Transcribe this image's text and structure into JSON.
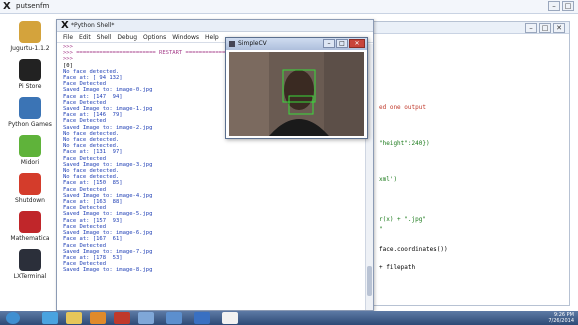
{
  "outer": {
    "title": "putsenfm"
  },
  "desktop_icons": [
    {
      "label": "Jugurtu-1.1.2",
      "color": "#d4a33c"
    },
    {
      "label": "Pi Store",
      "color": "#222222"
    },
    {
      "label": "Python Games",
      "color": "#3b74b5"
    },
    {
      "label": "Midori",
      "color": "#5fb33a"
    },
    {
      "label": "Shutdown",
      "color": "#d43c2b"
    },
    {
      "label": "Mathematica",
      "color": "#c0262a"
    },
    {
      "label": "LXTerminal",
      "color": "#2b2f3a"
    }
  ],
  "shell": {
    "title": "*Python Shell*",
    "menu": [
      "File",
      "Edit",
      "Shell",
      "Debug",
      "Options",
      "Windows",
      "Help"
    ],
    "lines": [
      {
        "text": ">>> ",
        "color": "#a53d8a"
      },
      {
        "text": ">>> ======================== RESTART ========================",
        "color": "#a53d8a"
      },
      {
        "text": ">>> ",
        "color": "#a53d8a"
      },
      {
        "text": "[0]",
        "color": "#000000"
      },
      {
        "text": "No face detected.",
        "color": "#1f3fb5"
      },
      {
        "text": "Face at: [ 94 132]",
        "color": "#1f3fb5"
      },
      {
        "text": "Face Detected",
        "color": "#1f3fb5"
      },
      {
        "text": "Saved Image to: image-0.jpg",
        "color": "#1f3fb5"
      },
      {
        "text": "Face at: [147  94]",
        "color": "#1f3fb5"
      },
      {
        "text": "Face Detected",
        "color": "#1f3fb5"
      },
      {
        "text": "Saved Image to: image-1.jpg",
        "color": "#1f3fb5"
      },
      {
        "text": "Face at: [146  79]",
        "color": "#1f3fb5"
      },
      {
        "text": "Face Detected",
        "color": "#1f3fb5"
      },
      {
        "text": "Saved Image to: image-2.jpg",
        "color": "#1f3fb5"
      },
      {
        "text": "No face detected.",
        "color": "#1f3fb5"
      },
      {
        "text": "No face detected.",
        "color": "#1f3fb5"
      },
      {
        "text": "No face detected.",
        "color": "#1f3fb5"
      },
      {
        "text": "Face at: [131  97]",
        "color": "#1f3fb5"
      },
      {
        "text": "Face Detected",
        "color": "#1f3fb5"
      },
      {
        "text": "Saved Image to: image-3.jpg",
        "color": "#1f3fb5"
      },
      {
        "text": "No face detected.",
        "color": "#1f3fb5"
      },
      {
        "text": "No face detected.",
        "color": "#1f3fb5"
      },
      {
        "text": "Face at: [150  85]",
        "color": "#1f3fb5"
      },
      {
        "text": "Face Detected",
        "color": "#1f3fb5"
      },
      {
        "text": "Saved Image to: image-4.jpg",
        "color": "#1f3fb5"
      },
      {
        "text": "Face at: [163  88]",
        "color": "#1f3fb5"
      },
      {
        "text": "Face Detected",
        "color": "#1f3fb5"
      },
      {
        "text": "Saved Image to: image-5.jpg",
        "color": "#1f3fb5"
      },
      {
        "text": "Face at: [157  93]",
        "color": "#1f3fb5"
      },
      {
        "text": "Face Detected",
        "color": "#1f3fb5"
      },
      {
        "text": "Saved Image to: image-6.jpg",
        "color": "#1f3fb5"
      },
      {
        "text": "Face at: [167  61]",
        "color": "#1f3fb5"
      },
      {
        "text": "Face Detected",
        "color": "#1f3fb5"
      },
      {
        "text": "Saved Image to: image-7.jpg",
        "color": "#1f3fb5"
      },
      {
        "text": "Face at: [178  53]",
        "color": "#1f3fb5"
      },
      {
        "text": "Face Detected",
        "color": "#1f3fb5"
      },
      {
        "text": "Saved Image to: image-8.jpg",
        "color": "#1f3fb5"
      }
    ]
  },
  "simplecv": {
    "title": "SimpleCV"
  },
  "editor": {
    "lines": [
      {
        "text": "ed one output",
        "color": "#c0392b"
      },
      {
        "text": "\"height\":240})",
        "color": "#1b7a1b"
      },
      {
        "text": "xml')",
        "color": "#1b7a1b"
      },
      {
        "text": "r(x) + \".jpg\"",
        "color": "#1b7a1b"
      },
      {
        "text": "\"",
        "color": "#1b7a1b"
      },
      {
        "text": "face.coordinates())",
        "color": "#000000"
      },
      {
        "text": "+ filepath",
        "color": "#000000"
      }
    ]
  },
  "taskbar": {
    "items": [
      {
        "name": "start-orb",
        "color": "#3f8fd1"
      },
      {
        "name": "ie-icon",
        "color": "#4aa3e0"
      },
      {
        "name": "explorer-icon",
        "color": "#e6c65a"
      },
      {
        "name": "media-icon",
        "color": "#e08a2b"
      },
      {
        "name": "app-icon",
        "color": "#c0392b"
      },
      {
        "name": "mail-icon",
        "color": "#7fa7d8"
      },
      {
        "name": "photo-icon",
        "color": "#5c8fce"
      },
      {
        "name": "window-icon",
        "color": "#3970c2"
      },
      {
        "name": "x-icon",
        "color": "#f2f2f2"
      }
    ],
    "time": "9:26 PM",
    "date": "7/26/2014"
  }
}
